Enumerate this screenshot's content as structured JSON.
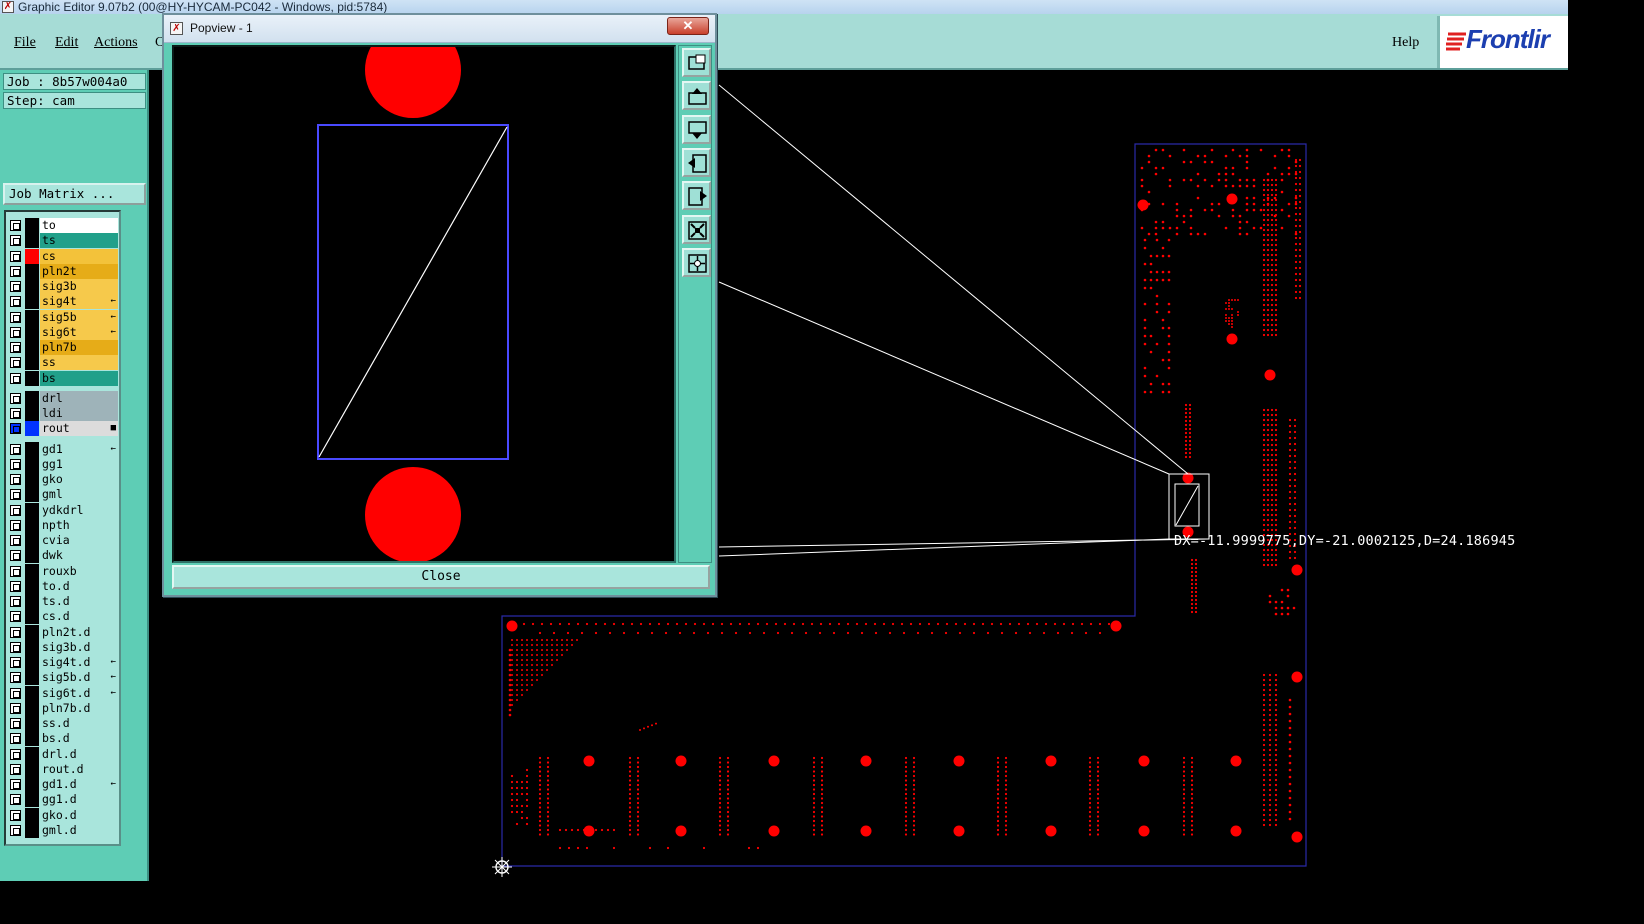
{
  "window": {
    "title": "Graphic Editor 9.07b2 (00@HY-HYCAM-PC042 - Windows, pid:5784)"
  },
  "menubar": {
    "file": "File",
    "edit": "Edit",
    "actions": "Actions",
    "hidden_menu": "C",
    "help": "Help",
    "logo": "Frontlir"
  },
  "job_panel": {
    "job": "Job : 8b57w004a0",
    "step": "Step: cam",
    "job_matrix_button": "Job Matrix ..."
  },
  "layers": [
    {
      "name": "to",
      "color": "#ffffff",
      "swatch": "#000000",
      "flag": ""
    },
    {
      "name": "ts",
      "color": "#21a08a",
      "swatch": "#000000",
      "flag": ""
    },
    {
      "name": "cs",
      "color": "#f3c23a",
      "swatch": "#ff0000",
      "flag": ""
    },
    {
      "name": "pln2t",
      "color": "#e6ac18",
      "swatch": "#000000",
      "flag": ""
    },
    {
      "name": "sig3b",
      "color": "#f6c94b",
      "swatch": "#000000",
      "flag": ""
    },
    {
      "name": "sig4t",
      "color": "#f6c94b",
      "swatch": "#000000",
      "flag": "←"
    },
    {
      "name": "sig5b",
      "color": "#f6c94b",
      "swatch": "#000000",
      "flag": "←"
    },
    {
      "name": "sig6t",
      "color": "#f6c94b",
      "swatch": "#000000",
      "flag": "←"
    },
    {
      "name": "pln7b",
      "color": "#e6ac18",
      "swatch": "#000000",
      "flag": ""
    },
    {
      "name": "ss",
      "color": "#f6c94b",
      "swatch": "#000000",
      "flag": ""
    },
    {
      "name": "bs",
      "color": "#21a08a",
      "swatch": "#000000",
      "flag": ""
    },
    {
      "name": "drl",
      "color": "#9eb3b9",
      "swatch": "#000000",
      "flag": ""
    },
    {
      "name": "ldi",
      "color": "#9eb3b9",
      "swatch": "#000000",
      "flag": ""
    },
    {
      "name": "rout",
      "color": "#dcdcdc",
      "swatch": "#0033ff",
      "flag": "■"
    },
    {
      "name": "gd1",
      "color": "#a9e5dc",
      "swatch": "#000000",
      "flag": "←"
    },
    {
      "name": "gg1",
      "color": "#a9e5dc",
      "swatch": "#000000",
      "flag": ""
    },
    {
      "name": "gko",
      "color": "#a9e5dc",
      "swatch": "#000000",
      "flag": ""
    },
    {
      "name": "gml",
      "color": "#a9e5dc",
      "swatch": "#000000",
      "flag": ""
    },
    {
      "name": "ydkdrl",
      "color": "#a9e5dc",
      "swatch": "#000000",
      "flag": ""
    },
    {
      "name": "npth",
      "color": "#a9e5dc",
      "swatch": "#000000",
      "flag": ""
    },
    {
      "name": "cvia",
      "color": "#a9e5dc",
      "swatch": "#000000",
      "flag": ""
    },
    {
      "name": "dwk",
      "color": "#a9e5dc",
      "swatch": "#000000",
      "flag": ""
    },
    {
      "name": "rouxb",
      "color": "#a9e5dc",
      "swatch": "#000000",
      "flag": ""
    },
    {
      "name": "to.d",
      "color": "#a9e5dc",
      "swatch": "#000000",
      "flag": ""
    },
    {
      "name": "ts.d",
      "color": "#a9e5dc",
      "swatch": "#000000",
      "flag": ""
    },
    {
      "name": "cs.d",
      "color": "#a9e5dc",
      "swatch": "#000000",
      "flag": ""
    },
    {
      "name": "pln2t.d",
      "color": "#a9e5dc",
      "swatch": "#000000",
      "flag": ""
    },
    {
      "name": "sig3b.d",
      "color": "#a9e5dc",
      "swatch": "#000000",
      "flag": ""
    },
    {
      "name": "sig4t.d",
      "color": "#a9e5dc",
      "swatch": "#000000",
      "flag": "←"
    },
    {
      "name": "sig5b.d",
      "color": "#a9e5dc",
      "swatch": "#000000",
      "flag": "←"
    },
    {
      "name": "sig6t.d",
      "color": "#a9e5dc",
      "swatch": "#000000",
      "flag": "←"
    },
    {
      "name": "pln7b.d",
      "color": "#a9e5dc",
      "swatch": "#000000",
      "flag": ""
    },
    {
      "name": "ss.d",
      "color": "#a9e5dc",
      "swatch": "#000000",
      "flag": ""
    },
    {
      "name": "bs.d",
      "color": "#a9e5dc",
      "swatch": "#000000",
      "flag": ""
    },
    {
      "name": "drl.d",
      "color": "#a9e5dc",
      "swatch": "#000000",
      "flag": ""
    },
    {
      "name": "rout.d",
      "color": "#a9e5dc",
      "swatch": "#000000",
      "flag": ""
    },
    {
      "name": "gd1.d",
      "color": "#a9e5dc",
      "swatch": "#000000",
      "flag": "←"
    },
    {
      "name": "gg1.d",
      "color": "#a9e5dc",
      "swatch": "#000000",
      "flag": ""
    },
    {
      "name": "gko.d",
      "color": "#a9e5dc",
      "swatch": "#000000",
      "flag": ""
    },
    {
      "name": "gml.d",
      "color": "#a9e5dc",
      "swatch": "#000000",
      "flag": ""
    }
  ],
  "popview": {
    "title": "Popview - 1",
    "close_button": "Close",
    "close_x": "✕",
    "tools": [
      "zoom-window-icon",
      "pan-up-icon",
      "pan-down-icon",
      "pan-left-icon",
      "pan-right-icon",
      "zoom-fit-icon",
      "zoom-center-icon"
    ]
  },
  "canvas": {
    "measure_readout": "DX=-11.9999775,DY=-21.0002125,D=24.186945"
  },
  "colors": {
    "panel": "#5ecdb5",
    "pad": "#ff0000",
    "outline": "#2a2aa8",
    "line": "#ffffff"
  }
}
